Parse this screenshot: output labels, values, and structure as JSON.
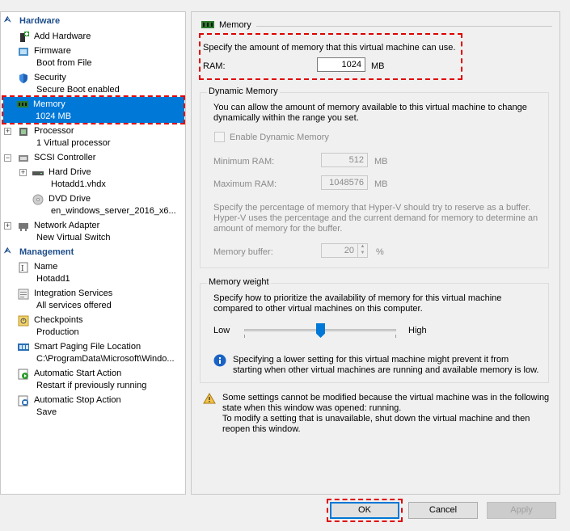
{
  "tree": {
    "hardware_header": "Hardware",
    "management_header": "Management",
    "items": [
      {
        "title": "Add Hardware",
        "sub": ""
      },
      {
        "title": "Firmware",
        "sub": "Boot from File"
      },
      {
        "title": "Security",
        "sub": "Secure Boot enabled"
      },
      {
        "title": "Memory",
        "sub": "1024 MB"
      },
      {
        "title": "Processor",
        "sub": "1 Virtual processor"
      },
      {
        "title": "SCSI Controller",
        "sub": ""
      },
      {
        "title": "Hard Drive",
        "sub": "Hotadd1.vhdx"
      },
      {
        "title": "DVD Drive",
        "sub": "en_windows_server_2016_x6..."
      },
      {
        "title": "Network Adapter",
        "sub": "New Virtual Switch"
      },
      {
        "title": "Name",
        "sub": "Hotadd1"
      },
      {
        "title": "Integration Services",
        "sub": "All services offered"
      },
      {
        "title": "Checkpoints",
        "sub": "Production"
      },
      {
        "title": "Smart Paging File Location",
        "sub": "C:\\ProgramData\\Microsoft\\Windo..."
      },
      {
        "title": "Automatic Start Action",
        "sub": "Restart if previously running"
      },
      {
        "title": "Automatic Stop Action",
        "sub": "Save"
      }
    ]
  },
  "memory": {
    "header": "Memory",
    "intro": "Specify the amount of memory that this virtual machine can use.",
    "ram_label": "RAM:",
    "ram_value": "1024",
    "ram_unit": "MB",
    "dynamic": {
      "title": "Dynamic Memory",
      "desc": "You can allow the amount of memory available to this virtual machine to change dynamically within the range you set.",
      "enable_label": "Enable Dynamic Memory",
      "enabled": false,
      "min_label": "Minimum RAM:",
      "min_value": "512",
      "min_unit": "MB",
      "max_label": "Maximum RAM:",
      "max_value": "1048576",
      "max_unit": "MB",
      "buffer_desc": "Specify the percentage of memory that Hyper-V should try to reserve as a buffer. Hyper-V uses the percentage and the current demand for memory to determine an amount of memory for the buffer.",
      "buffer_label": "Memory buffer:",
      "buffer_value": "20",
      "buffer_unit": "%"
    },
    "weight": {
      "title": "Memory weight",
      "desc": "Specify how to prioritize the availability of memory for this virtual machine compared to other virtual machines on this computer.",
      "low": "Low",
      "high": "High",
      "level": 0.5,
      "info": "Specifying a lower setting for this virtual machine might prevent it from starting when other virtual machines are running and available memory is low."
    },
    "warning": "Some settings cannot be modified because the virtual machine was in the following state when this window was opened: running.\nTo modify a setting that is unavailable, shut down the virtual machine and then reopen this window."
  },
  "buttons": {
    "ok": "OK",
    "cancel": "Cancel",
    "apply": "Apply"
  },
  "colors": {
    "selection": "#0078d7",
    "highlight_box": "#e00000",
    "section_header": "#1e4e8c"
  }
}
